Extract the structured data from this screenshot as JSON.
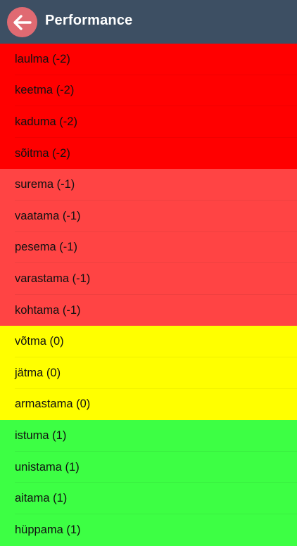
{
  "header": {
    "title": "Performance",
    "back_icon": "arrow-left-icon",
    "bar_color": "#3d4f63",
    "back_button_color": "#e06a72"
  },
  "level_colors": {
    "-2": "#ff0000",
    "-1": "#ff4444",
    "0": "#ffff00",
    "1": "#3dff44"
  },
  "items": [
    {
      "label": "laulma (-2)",
      "level": -2
    },
    {
      "label": "keetma (-2)",
      "level": -2
    },
    {
      "label": "kaduma (-2)",
      "level": -2
    },
    {
      "label": "sõitma (-2)",
      "level": -2
    },
    {
      "label": "surema (-1)",
      "level": -1
    },
    {
      "label": "vaatama (-1)",
      "level": -1
    },
    {
      "label": "pesema (-1)",
      "level": -1
    },
    {
      "label": "varastama (-1)",
      "level": -1
    },
    {
      "label": "kohtama (-1)",
      "level": -1
    },
    {
      "label": "võtma (0)",
      "level": 0
    },
    {
      "label": "jätma (0)",
      "level": 0
    },
    {
      "label": "armastama (0)",
      "level": 0
    },
    {
      "label": "istuma (1)",
      "level": 1
    },
    {
      "label": "unistama (1)",
      "level": 1
    },
    {
      "label": "aitama (1)",
      "level": 1
    },
    {
      "label": "hüppama (1)",
      "level": 1
    }
  ]
}
